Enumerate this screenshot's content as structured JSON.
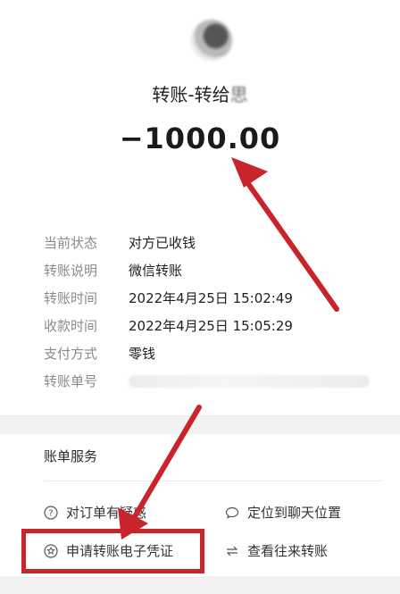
{
  "header": {
    "title_prefix": "转账-转给",
    "title_name_blurred": "思",
    "amount": "−1000.00"
  },
  "details": [
    {
      "label": "当前状态",
      "value": "对方已收钱"
    },
    {
      "label": "转账说明",
      "value": "微信转账"
    },
    {
      "label": "转账时间",
      "value": "2022年4月25日 15:02:49"
    },
    {
      "label": "收款时间",
      "value": "2022年4月25日 15:05:29"
    },
    {
      "label": "支付方式",
      "value": "零钱"
    },
    {
      "label": "转账单号",
      "value": ""
    }
  ],
  "services": {
    "section_title": "账单服务",
    "items": [
      {
        "label": "对订单有疑惑",
        "icon": "question-circle-icon"
      },
      {
        "label": "定位到聊天位置",
        "icon": "chat-bubble-icon"
      },
      {
        "label": "申请转账电子凭证",
        "icon": "star-badge-icon"
      },
      {
        "label": "查看往来转账",
        "icon": "exchange-arrows-icon"
      }
    ]
  },
  "annotation_color": "#c9232c"
}
